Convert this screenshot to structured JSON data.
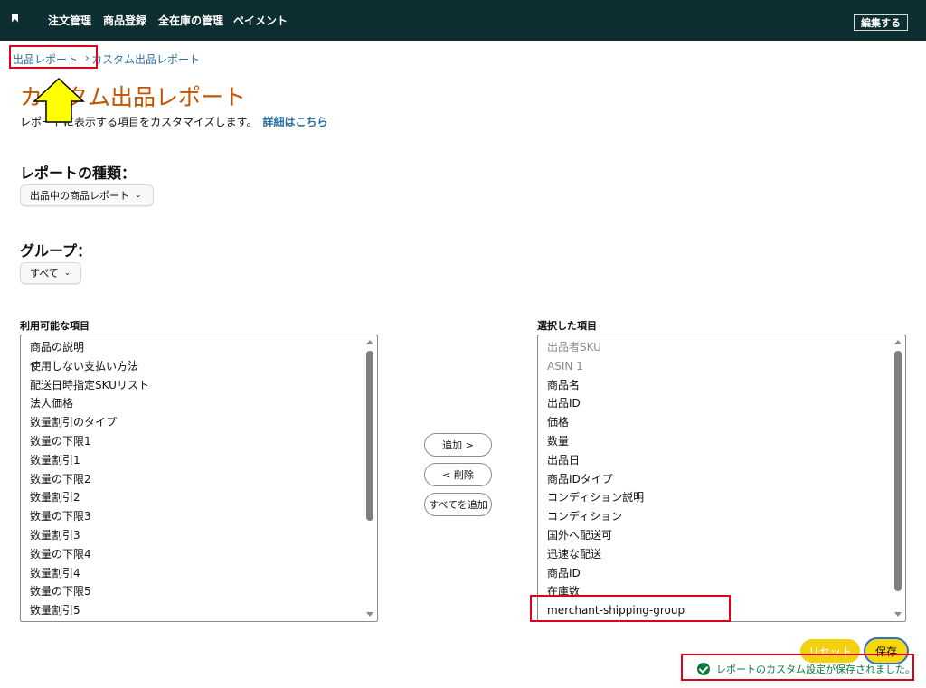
{
  "nav": {
    "items": [
      "注文管理",
      "商品登録",
      "全在庫の管理",
      "ペイメント"
    ],
    "edit_button": "編集する"
  },
  "breadcrumb": {
    "parent": "出品レポート",
    "separator": "›",
    "current": "カスタム出品レポート"
  },
  "page": {
    "title": "カスタム出品レポート",
    "description": "レポートに表示する項目をカスタマイズします。",
    "details_link": "詳細はこちら"
  },
  "report_type": {
    "label": "レポートの種類：",
    "selected": "出品中の商品レポート"
  },
  "group": {
    "label": "グループ：",
    "selected": "すべて"
  },
  "available": {
    "title": "利用可能な項目",
    "items": [
      "商品の説明",
      "使用しない支払い方法",
      "配送日時指定SKUリスト",
      "法人価格",
      "数量割引のタイプ",
      "数量の下限1",
      "数量割引1",
      "数量の下限2",
      "数量割引2",
      "数量の下限3",
      "数量割引3",
      "数量の下限4",
      "数量割引4",
      "数量の下限5",
      "数量割引5"
    ]
  },
  "selected": {
    "title": "選択した項目",
    "items": [
      {
        "label": "出品者SKU",
        "muted": true
      },
      {
        "label": "ASIN 1",
        "muted": true
      },
      {
        "label": "商品名",
        "muted": false
      },
      {
        "label": "出品ID",
        "muted": false
      },
      {
        "label": "価格",
        "muted": false
      },
      {
        "label": "数量",
        "muted": false
      },
      {
        "label": "出品日",
        "muted": false
      },
      {
        "label": "商品IDタイプ",
        "muted": false
      },
      {
        "label": "コンディション説明",
        "muted": false
      },
      {
        "label": "コンディション",
        "muted": false
      },
      {
        "label": "国外へ配送可",
        "muted": false
      },
      {
        "label": "迅速な配送",
        "muted": false
      },
      {
        "label": "商品ID",
        "muted": false
      },
      {
        "label": "在庫数",
        "muted": false
      },
      {
        "label": "merchant-shipping-group",
        "muted": false
      }
    ]
  },
  "buttons": {
    "add": "追加 >",
    "remove": "< 削除",
    "add_all": "すべてを追加",
    "reset": "リセット",
    "save": "保存"
  },
  "status_message": "レポートのカスタム設定が保存されました。",
  "colors": {
    "nav_bg": "#0d2e30",
    "title": "#c45500",
    "link": "#2b6f9e",
    "highlight_box": "#e0001b",
    "arrow": "#ffff00",
    "button_yellow": "#f7d80a",
    "success": "#0a7b3b"
  }
}
